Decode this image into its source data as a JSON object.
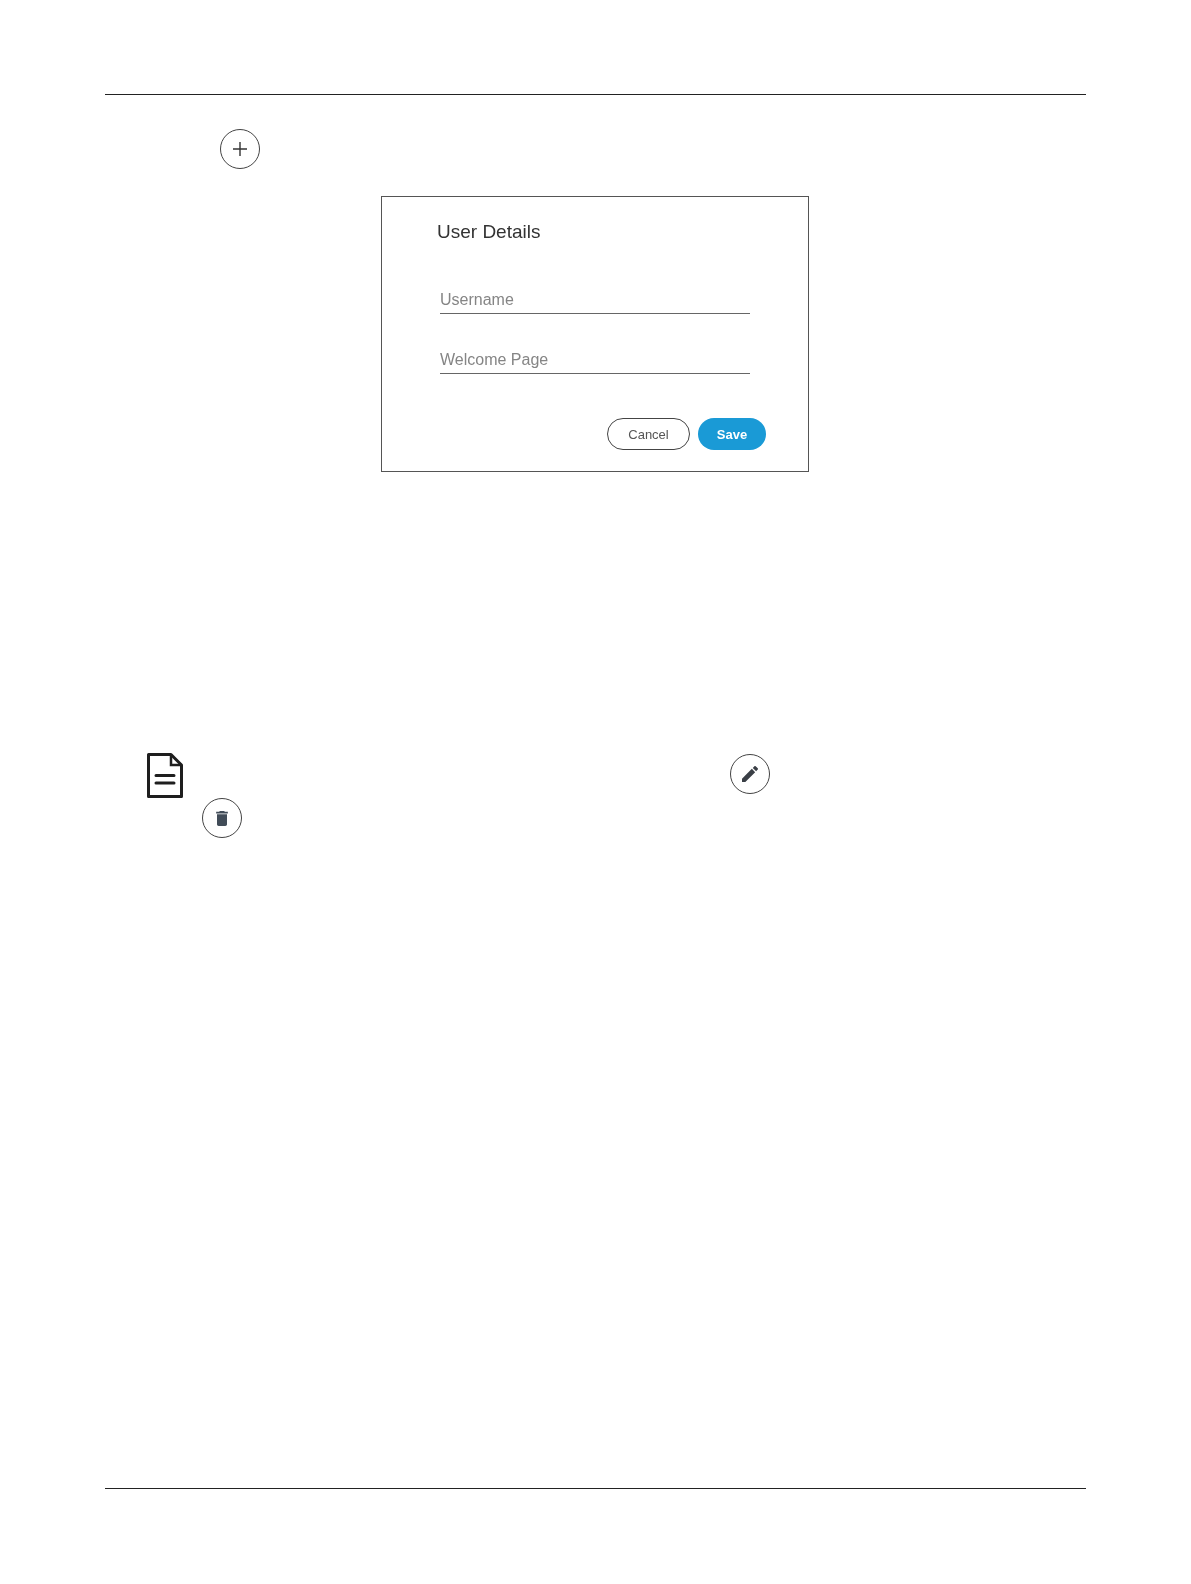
{
  "dialog": {
    "title": "User Details",
    "fields": [
      {
        "placeholder": "Username"
      },
      {
        "placeholder": "Welcome Page"
      }
    ],
    "buttons": [
      {
        "label": "Cancel",
        "kind": "secondary"
      },
      {
        "label": "Save",
        "kind": "primary"
      }
    ]
  }
}
